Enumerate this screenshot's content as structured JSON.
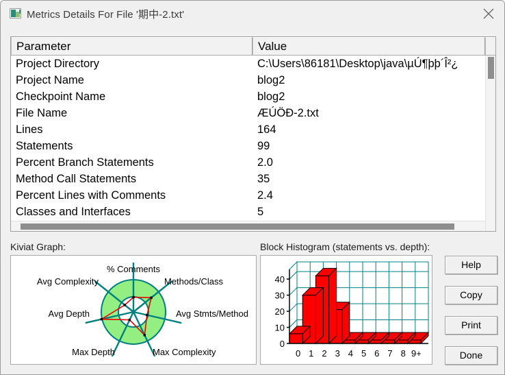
{
  "window": {
    "title": "Metrics Details For File '期中-2.txt'",
    "icon": "metrics-window-icon",
    "close_label": "×"
  },
  "table": {
    "columns": [
      "Parameter",
      "Value"
    ],
    "rows": [
      {
        "parameter": "Project Directory",
        "value": "C:\\Users\\86181\\Desktop\\java\\µÚ¶þþ´Î²¿"
      },
      {
        "parameter": "Project Name",
        "value": "blog2"
      },
      {
        "parameter": "Checkpoint Name",
        "value": "blog2"
      },
      {
        "parameter": "File Name",
        "value": "ÆÚÖÐ-2.txt"
      },
      {
        "parameter": "Lines",
        "value": "164"
      },
      {
        "parameter": "Statements",
        "value": "99"
      },
      {
        "parameter": "Percent Branch Statements",
        "value": "2.0"
      },
      {
        "parameter": "Method Call Statements",
        "value": "35"
      },
      {
        "parameter": "Percent Lines with Comments",
        "value": "2.4"
      },
      {
        "parameter": "Classes and Interfaces",
        "value": "5"
      }
    ]
  },
  "kiviat": {
    "label": "Kiviat Graph:",
    "axes": [
      "% Comments",
      "Methods/Class",
      "Avg Stmts/Method",
      "Max Complexity",
      "Max Depth",
      "Avg Depth",
      "Avg Complexity"
    ],
    "colors": {
      "band": "#93ef82",
      "spoke": "#00807f",
      "trace": "#ee0000",
      "background": "#ffffff"
    }
  },
  "histogram": {
    "label": "Block Histogram (statements vs. depth):"
  },
  "chart_data": {
    "type": "bar",
    "title": "Block Histogram (statements vs. depth)",
    "xlabel": "",
    "ylabel": "",
    "categories": [
      "0",
      "1",
      "2",
      "3",
      "4",
      "5",
      "6",
      "7",
      "8",
      "9+"
    ],
    "values": [
      6,
      30,
      42,
      21,
      0,
      0,
      0,
      0,
      0,
      0
    ],
    "yticks": [
      0,
      10,
      20,
      30,
      40
    ],
    "ylim": [
      0,
      46
    ],
    "grid": true,
    "legend": "none",
    "bar_color": "#ff0000",
    "grid_color": "#008080"
  },
  "buttons": {
    "help": "Help",
    "copy": "Copy",
    "print": "Print",
    "done": "Done"
  }
}
